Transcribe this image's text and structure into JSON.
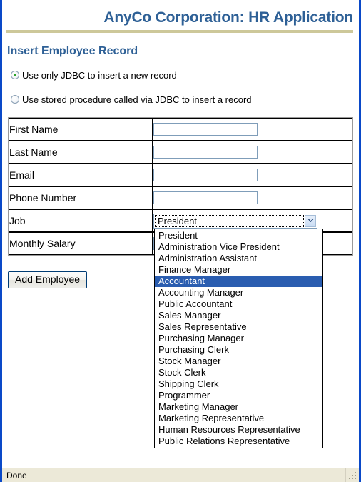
{
  "app": {
    "title": "AnyCo Corporation: HR Application",
    "heading": "Insert Employee Record",
    "accent_color": "#2e6096",
    "rule_color": "#cdc89a",
    "highlight_color": "#2a5db0",
    "frame_color": "#0a49c8"
  },
  "options_group": {
    "items": [
      {
        "label": "Use only JDBC to insert a new record",
        "checked": true
      },
      {
        "label": "Use stored procedure called via JDBC to insert a record",
        "checked": false
      }
    ]
  },
  "form": {
    "rows": [
      {
        "label": "First Name",
        "type": "text",
        "value": "",
        "placeholder": ""
      },
      {
        "label": "Last Name",
        "type": "text",
        "value": "",
        "placeholder": ""
      },
      {
        "label": "Email",
        "type": "text",
        "value": "",
        "placeholder": ""
      },
      {
        "label": "Phone Number",
        "type": "text",
        "value": "",
        "placeholder": ""
      },
      {
        "label": "Job",
        "type": "select",
        "value": "President",
        "placeholder": ""
      },
      {
        "label": "Monthly Salary",
        "type": "text",
        "value": "",
        "placeholder": ""
      }
    ],
    "submit_label": "Add Employee"
  },
  "job_select": {
    "selected_value": "President",
    "highlighted_option": "Accountant",
    "expanded": true,
    "arrow_icon": "chevron-down-icon",
    "options": [
      "President",
      "Administration Vice President",
      "Administration Assistant",
      "Finance Manager",
      "Accountant",
      "Accounting Manager",
      "Public Accountant",
      "Sales Manager",
      "Sales Representative",
      "Purchasing Manager",
      "Purchasing Clerk",
      "Stock Manager",
      "Stock Clerk",
      "Shipping Clerk",
      "Programmer",
      "Marketing Manager",
      "Marketing Representative",
      "Human Resources Representative",
      "Public Relations Representative"
    ]
  },
  "statusbar": {
    "message": "Done",
    "grip_icon": "resize-grip-icon"
  }
}
